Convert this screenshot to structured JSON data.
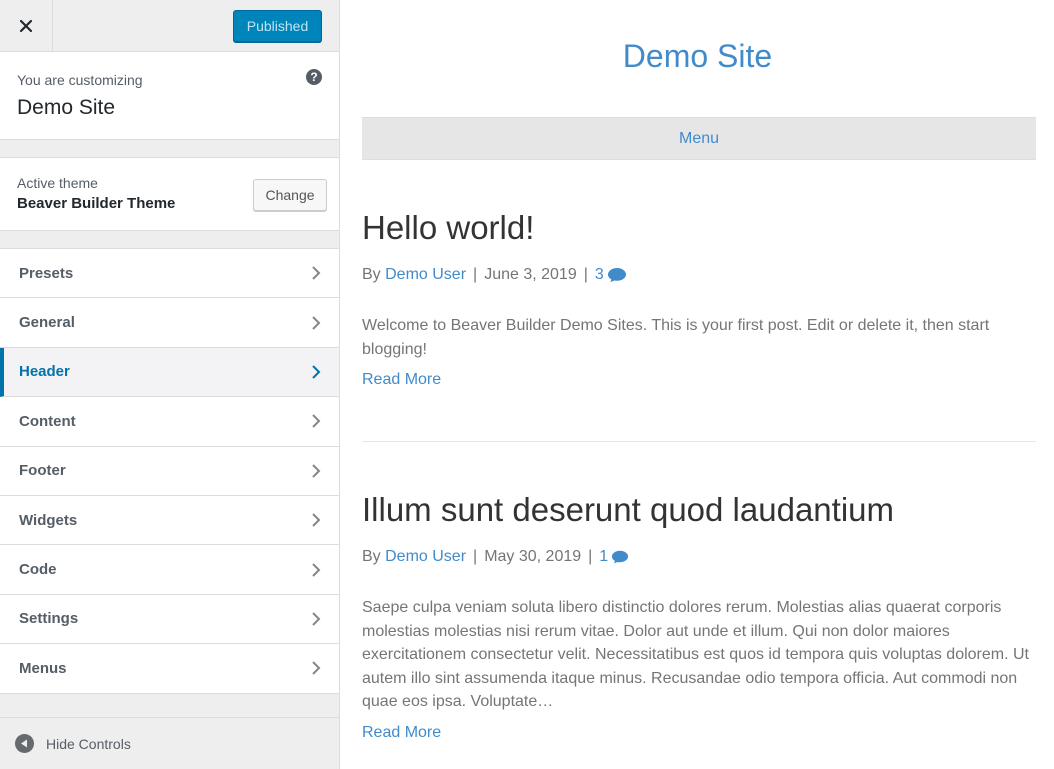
{
  "customizer": {
    "publish_label": "Published",
    "info_subtitle": "You are customizing",
    "info_title": "Demo Site",
    "help_symbol": "?",
    "theme_subtitle": "Active theme",
    "theme_name": "Beaver Builder Theme",
    "change_label": "Change",
    "sections": [
      {
        "label": "Presets",
        "active": false
      },
      {
        "label": "General",
        "active": false
      },
      {
        "label": "Header",
        "active": true
      },
      {
        "label": "Content",
        "active": false
      },
      {
        "label": "Footer",
        "active": false
      },
      {
        "label": "Widgets",
        "active": false
      },
      {
        "label": "Code",
        "active": false
      },
      {
        "label": "Settings",
        "active": false
      },
      {
        "label": "Menus",
        "active": false
      }
    ],
    "hide_controls_label": "Hide Controls"
  },
  "preview": {
    "site_title": "Demo Site",
    "nav_menu_label": "Menu",
    "posts": [
      {
        "title": "Hello world!",
        "by": "By",
        "author": "Demo User",
        "sep": "|",
        "date": "June 3, 2019",
        "comments": "3",
        "excerpt": "Welcome to Beaver Builder Demo Sites. This is your first post. Edit or delete it, then start blogging!",
        "read_more": "Read More"
      },
      {
        "title": "Illum sunt deserunt quod laudantium",
        "by": "By",
        "author": "Demo User",
        "sep": "|",
        "date": "May 30, 2019",
        "comments": "1",
        "excerpt": "Saepe culpa veniam soluta libero distinctio dolores rerum. Molestias alias quaerat corporis molestias molestias nisi rerum vitae. Dolor aut unde et illum. Qui non dolor maiores exercitationem consectetur velit. Necessitatibus est quos id tempora quis voluptas dolorem. Ut autem illo sint assumenda itaque minus. Recusandae odio tempora officia. Aut commodi non quae eos ipsa. Voluptate…",
        "read_more": "Read More"
      }
    ]
  },
  "colors": {
    "accent": "#0073aa",
    "publish": "#0085ba",
    "link": "#428bca"
  },
  "icons": [
    "close-icon",
    "help-icon",
    "chevron-right-icon",
    "comment-icon",
    "arrow-left-circle-icon"
  ]
}
